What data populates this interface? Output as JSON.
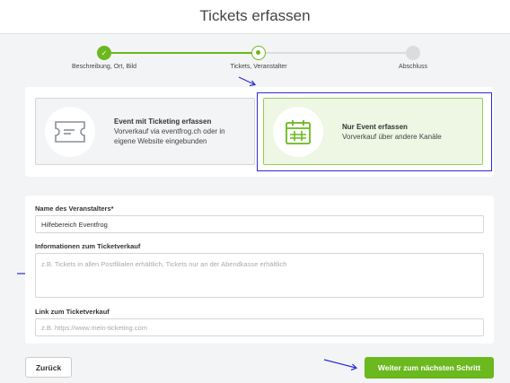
{
  "page": {
    "title": "Tickets erfassen"
  },
  "stepper": {
    "steps": [
      {
        "label": "Beschreibung, Ort, Bild",
        "state": "done"
      },
      {
        "label": "Tickets, Veranstalter",
        "state": "current"
      },
      {
        "label": "Abschluss",
        "state": "upcoming"
      }
    ],
    "check_glyph": "✓"
  },
  "options": {
    "ticketing": {
      "title": "Event mit Ticketing erfassen",
      "desc_line1": "Vorverkauf via eventfrog.ch oder in",
      "desc_line2": "eigene Website eingebunden",
      "icon": "ticket-icon"
    },
    "event_only": {
      "title": "Nur Event erfassen",
      "desc_line1": "Vorverkauf über andere Kanäle",
      "icon": "calendar-icon",
      "selected": true
    }
  },
  "form": {
    "organizer": {
      "label": "Name des Veranstalters*",
      "value": "Hilfebereich Eventfrog"
    },
    "ticket_info": {
      "label": "Informationen zum Ticketverkauf",
      "placeholder": "z.B. Tickets in allen Postfilialen erhältlich, Tickets nur an der Abendkasse erhältlich"
    },
    "ticket_link": {
      "label": "Link zum Ticketverkauf",
      "placeholder": "z.B. https://www.mein-ticketing.com"
    }
  },
  "buttons": {
    "back": "Zurück",
    "next": "Weiter zum nächsten Schritt"
  },
  "colors": {
    "accent_green": "#6bb81f",
    "annotation_blue": "#2d2bd9"
  }
}
